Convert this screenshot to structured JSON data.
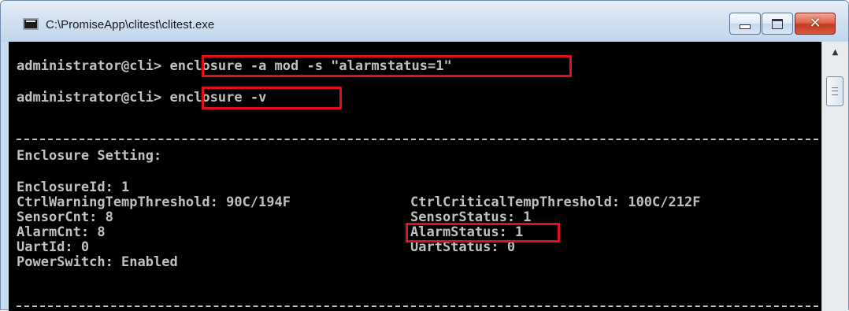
{
  "window": {
    "title": "C:\\PromiseApp\\clitest\\clitest.exe",
    "icon": "console-app-icon",
    "controls": {
      "minimize": "minimize-icon",
      "maximize": "maximize-icon",
      "close": "close-icon",
      "close_glyph": "✕"
    }
  },
  "console": {
    "commands": [
      {
        "prompt": "administrator@cli>",
        "command": "enclosure -a mod -s \"alarmstatus=1\""
      },
      {
        "prompt": "administrator@cli>",
        "command": "enclosure -v"
      }
    ],
    "section_title": "Enclosure Setting:",
    "settings_left": [
      "EnclosureId: 1",
      "CtrlWarningTempThreshold: 90C/194F",
      "SensorCnt: 8",
      "AlarmCnt: 8",
      "UartId: 0",
      "PowerSwitch: Enabled"
    ],
    "settings_right": [
      "CtrlCriticalTempThreshold: 100C/212F",
      "SensorStatus: 1",
      "AlarmStatus: 1",
      "UartStatus: 0"
    ]
  },
  "highlight_color": "#e0101a",
  "console_text_color": "#c0c0c0",
  "console_background": "#000000"
}
